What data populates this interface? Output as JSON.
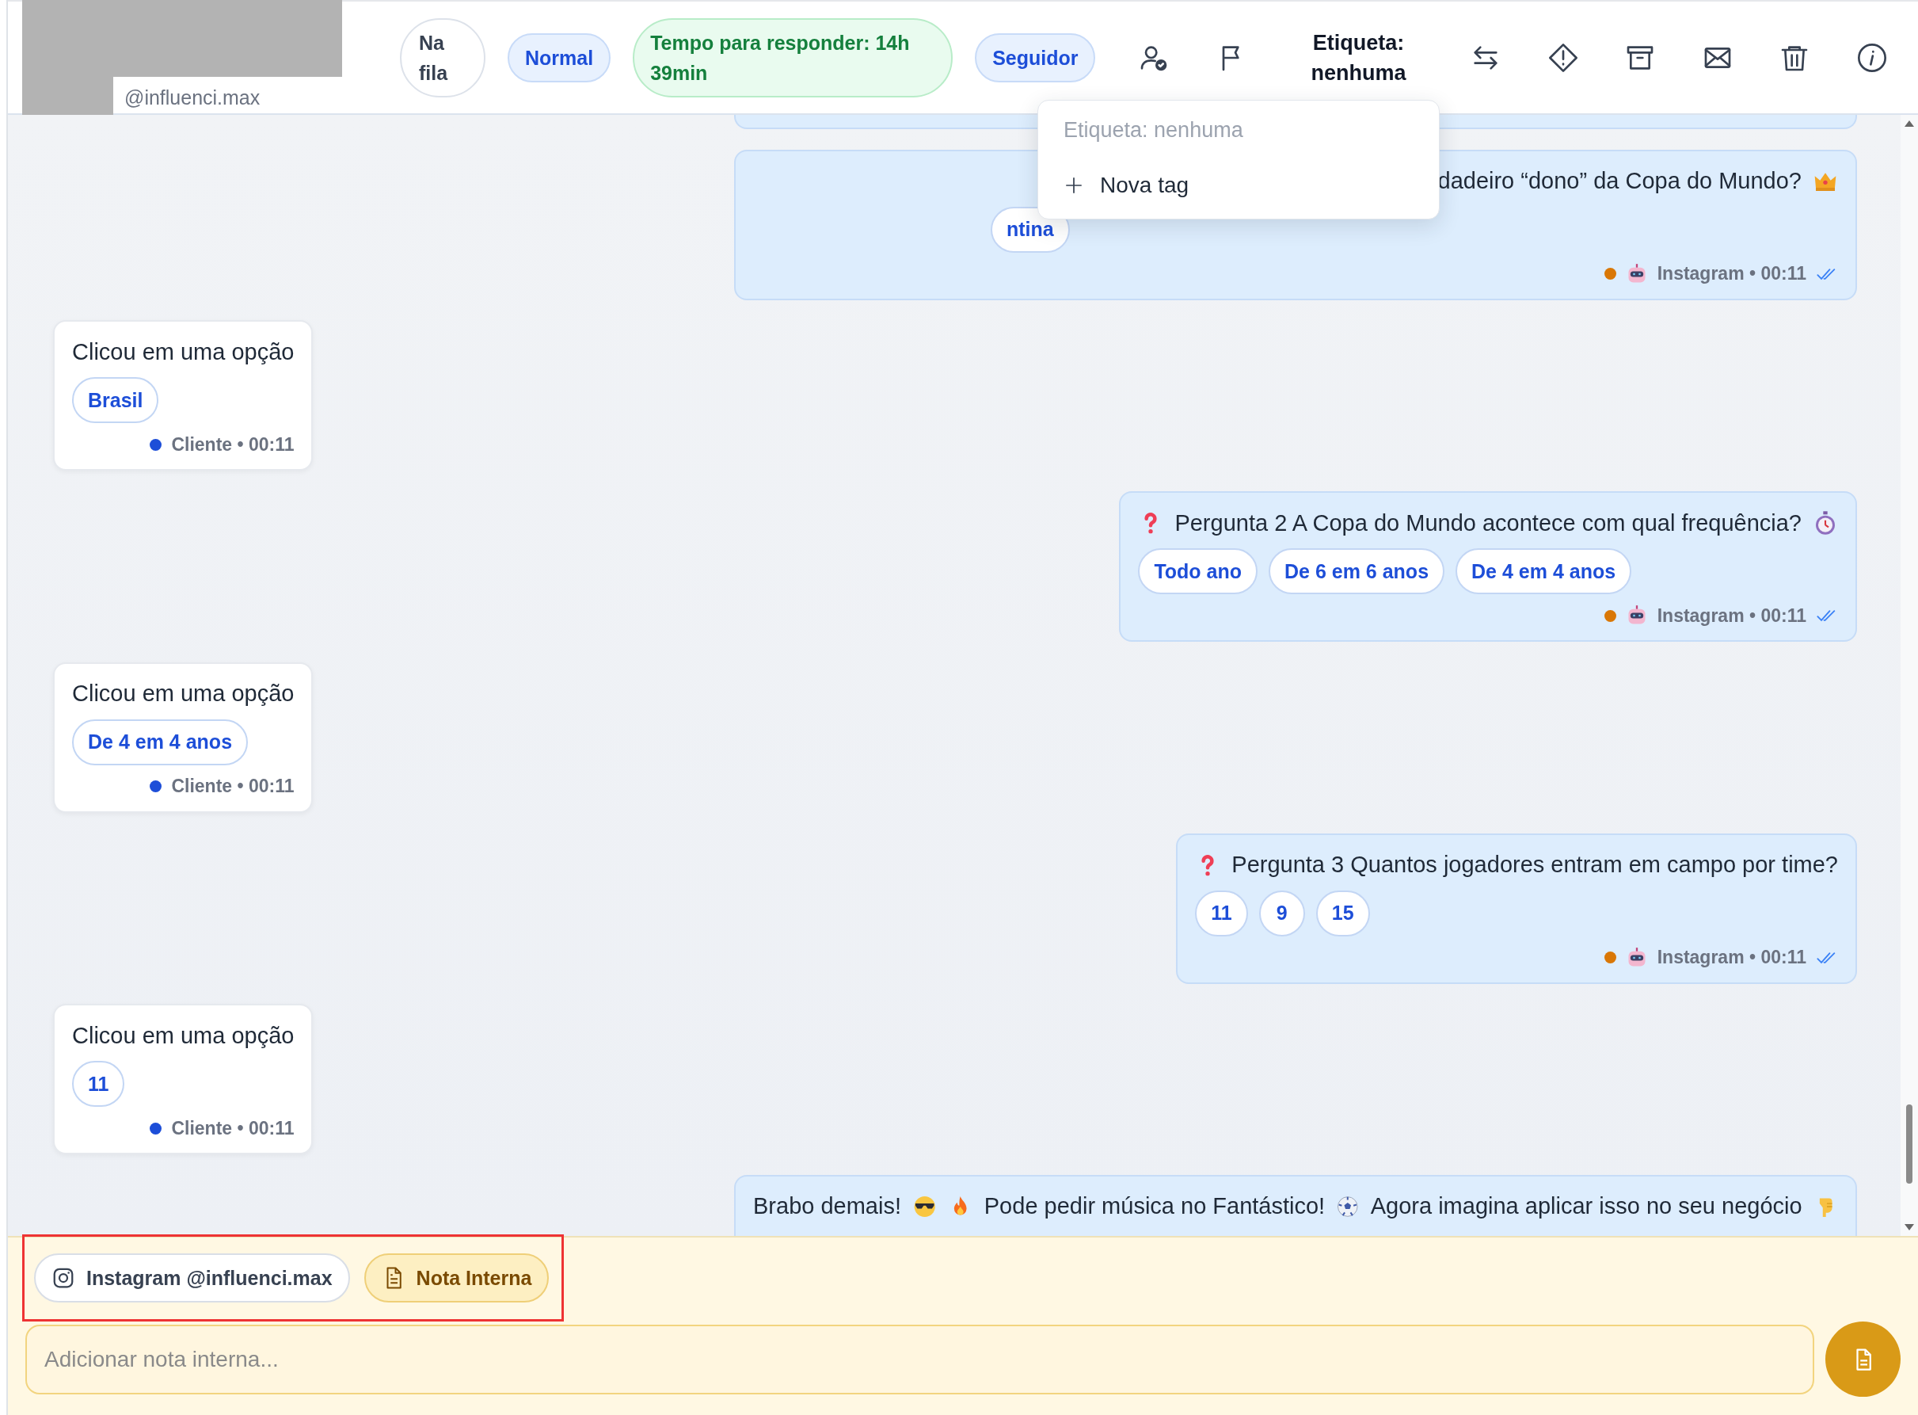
{
  "header": {
    "handle": "@influenci.max",
    "badges": [
      {
        "kind": "neutral",
        "label": "Na fila"
      },
      {
        "kind": "blue",
        "label": "Normal"
      },
      {
        "kind": "green",
        "label": "Tempo para responder: 14h 39min"
      },
      {
        "kind": "blue",
        "label": "Seguidor"
      }
    ],
    "tag_button": {
      "label": "Etiqueta: nenhuma"
    }
  },
  "tag_menu": {
    "open": true,
    "title": "Etiqueta: nenhuma",
    "items": [
      {
        "label": "Nova tag"
      }
    ]
  },
  "messages": [
    {
      "kind": "outgoing",
      "covered": true,
      "parts": [
        {
          "kind": "text",
          "text": "dadeiro “dono” da Copa do Mundo?"
        },
        {
          "kind": "crown"
        }
      ],
      "options": [
        {
          "label": "ntina"
        }
      ],
      "meta": "Instagram • 00:11",
      "color": "#d97706",
      "read": true
    },
    {
      "kind": "incoming",
      "parts": [
        {
          "kind": "text",
          "text": "Clicou em uma opção"
        }
      ],
      "options": [
        {
          "label": "Brasil"
        }
      ],
      "meta": "Cliente • 00:11",
      "color": "#1d4ed8"
    },
    {
      "kind": "outgoing",
      "parts": [
        {
          "kind": "question"
        },
        {
          "kind": "text",
          "text": "Pergunta 2 A Copa do Mundo acontece com qual frequência?"
        },
        {
          "kind": "stopwatch"
        }
      ],
      "options": [
        {
          "label": "Todo ano"
        },
        {
          "label": "De 6 em 6 anos"
        },
        {
          "label": "De 4 em 4 anos"
        }
      ],
      "meta": "Instagram • 00:11",
      "color": "#d97706",
      "read": true
    },
    {
      "kind": "incoming",
      "parts": [
        {
          "kind": "text",
          "text": "Clicou em uma opção"
        }
      ],
      "options": [
        {
          "label": "De 4 em 4 anos"
        }
      ],
      "meta": "Cliente • 00:11",
      "color": "#1d4ed8"
    },
    {
      "kind": "outgoing",
      "parts": [
        {
          "kind": "question"
        },
        {
          "kind": "text",
          "text": "Pergunta 3 Quantos jogadores entram em campo por time?"
        }
      ],
      "options": [
        {
          "label": "11"
        },
        {
          "label": "9"
        },
        {
          "label": "15"
        }
      ],
      "meta": "Instagram • 00:11",
      "color": "#d97706",
      "read": true
    },
    {
      "kind": "incoming",
      "parts": [
        {
          "kind": "text",
          "text": "Clicou em uma opção"
        }
      ],
      "options": [
        {
          "label": "11"
        }
      ],
      "meta": "Cliente • 00:11",
      "color": "#1d4ed8"
    },
    {
      "kind": "outgoing",
      "cut": true,
      "parts": [
        {
          "kind": "text",
          "text": "Brabo demais!"
        },
        {
          "kind": "sunglasses"
        },
        {
          "kind": "fire"
        },
        {
          "kind": "text",
          "text": "Pode pedir música no Fantástico!"
        },
        {
          "kind": "ball"
        },
        {
          "kind": "text",
          "text": "Agora imagina aplicar isso no seu negócio"
        },
        {
          "kind": "pointing"
        }
      ]
    }
  ],
  "composer": {
    "channels": [
      {
        "kind": "instagram",
        "label": "Instagram @influenci.max",
        "selected": false
      },
      {
        "kind": "note",
        "label": "Nota Interna",
        "selected": true
      }
    ],
    "placeholder": "Adicionar nota interna..."
  }
}
